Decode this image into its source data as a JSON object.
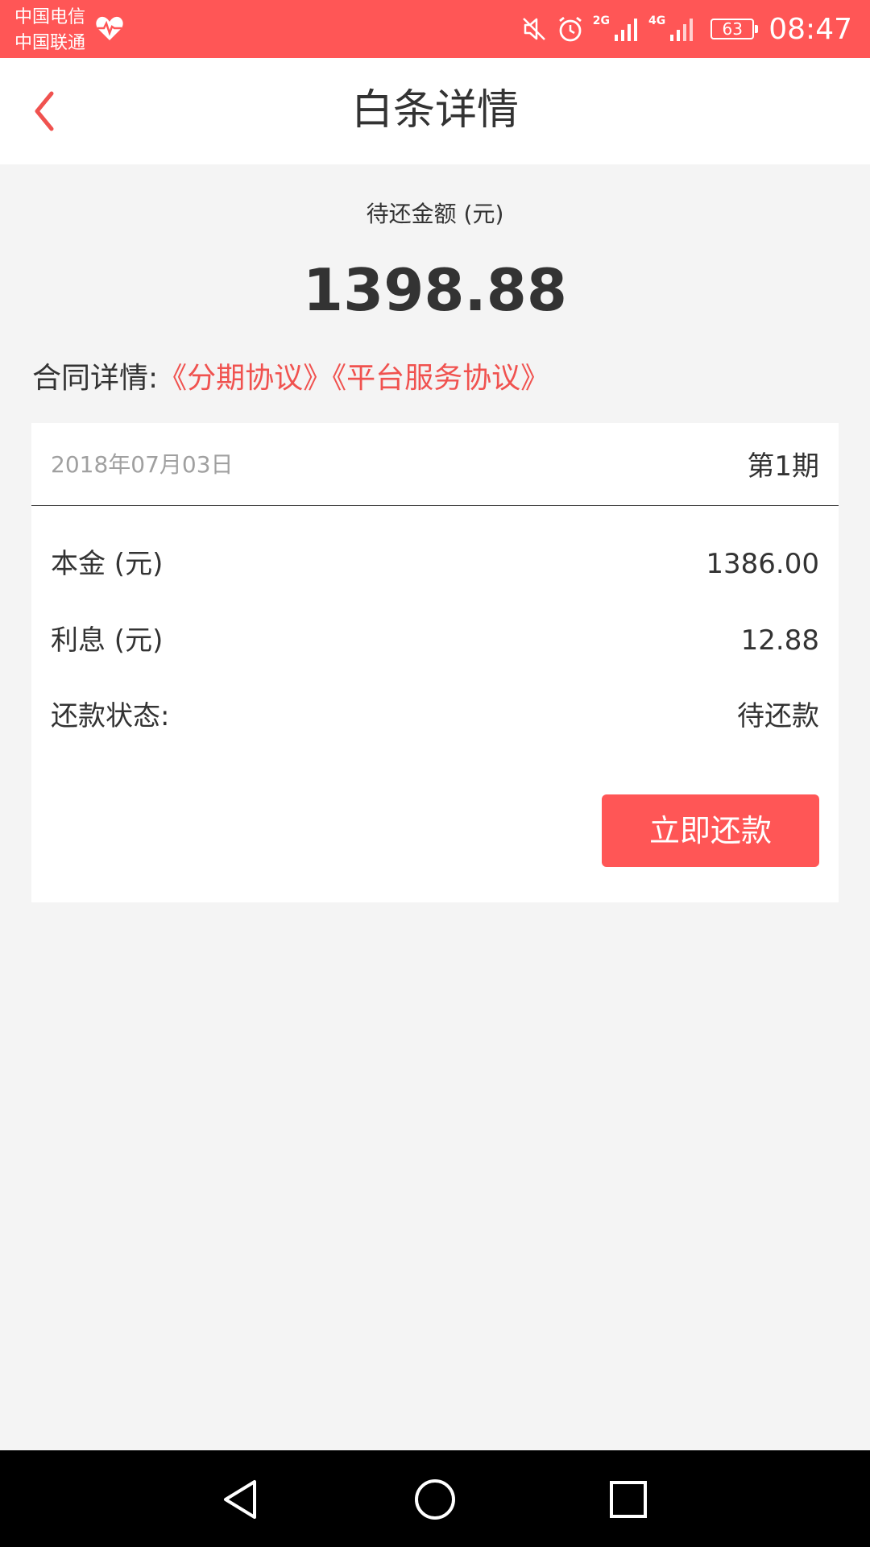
{
  "status_bar": {
    "carrier_1": "中国电信",
    "carrier_2": "中国联通",
    "net_2g": "2G",
    "net_4g": "4G",
    "battery": "63",
    "time": "08:47",
    "bg_color": "#ff5656",
    "icons": [
      "heart-pulse-icon",
      "mute-icon",
      "alarm-icon",
      "signal-icon",
      "signal-icon",
      "battery-icon"
    ]
  },
  "header": {
    "title": "白条详情",
    "back_icon": "chevron-left-icon",
    "accent": "#f0524f"
  },
  "summary": {
    "amount_label": "待还金额 (元)",
    "amount": "1398.88"
  },
  "contract": {
    "label": "合同详情:",
    "links": [
      "《分期协议》",
      "《平台服务协议》"
    ]
  },
  "bill": {
    "date": "2018年07月03日",
    "period": "第1期",
    "rows": [
      {
        "label": "本金 (元)",
        "value": "1386.00"
      },
      {
        "label": "利息 (元)",
        "value": "12.88"
      },
      {
        "label": "还款状态:",
        "value": "待还款"
      }
    ],
    "pay_button": "立即还款",
    "button_color": "#ff5656"
  },
  "nav_bar": {
    "icons": [
      "back-triangle-icon",
      "home-circle-icon",
      "recents-square-icon"
    ]
  }
}
